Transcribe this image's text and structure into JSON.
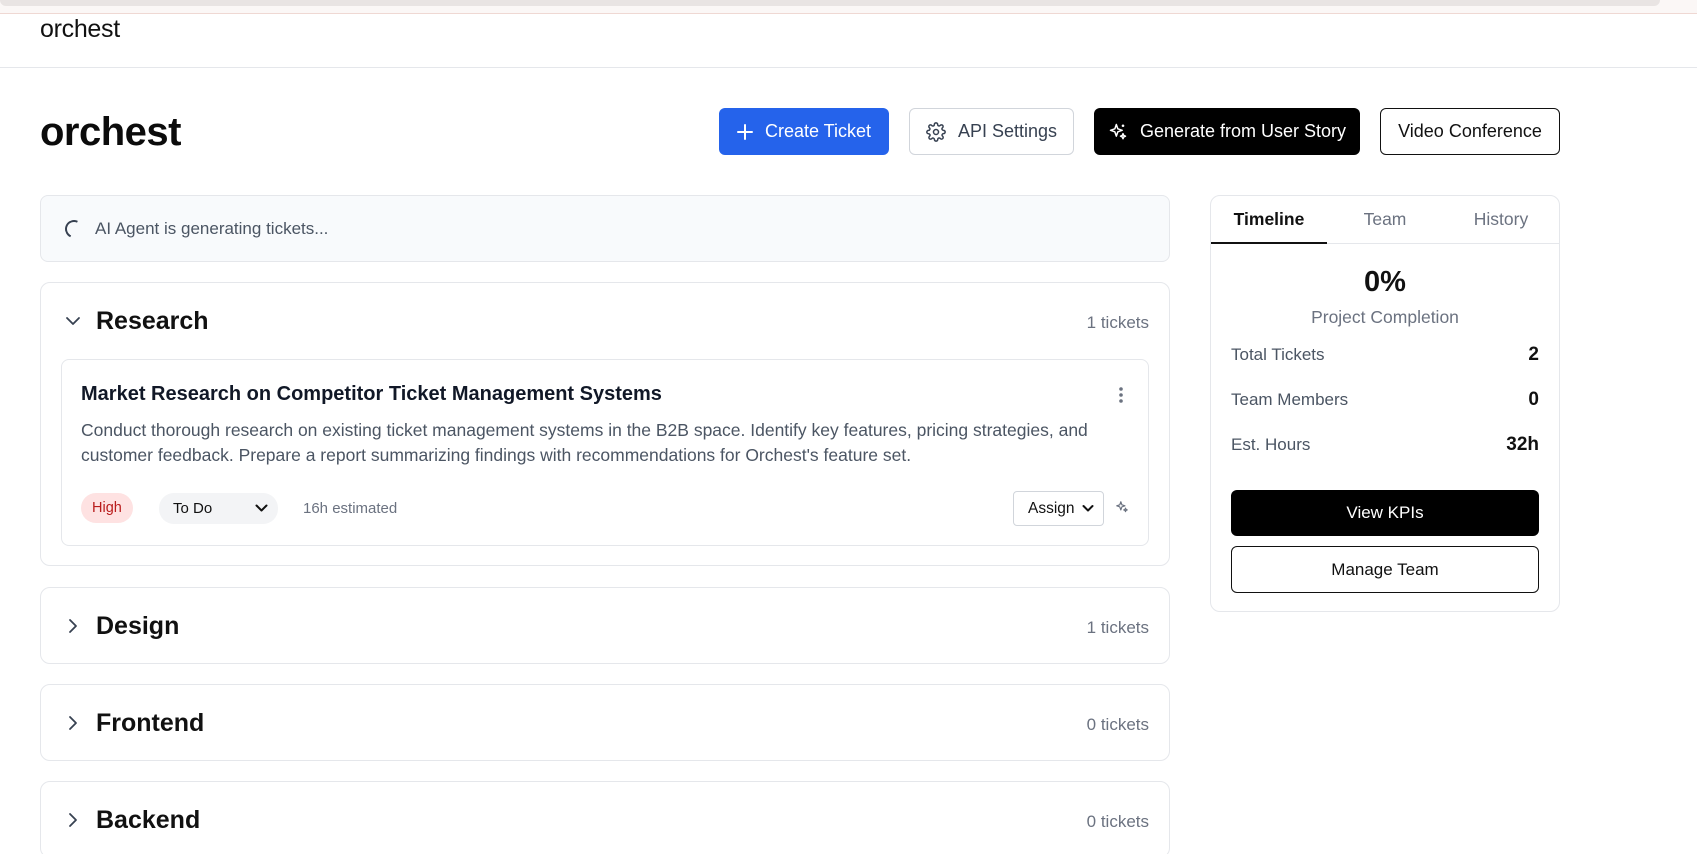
{
  "app": {
    "brand": "orchest"
  },
  "page": {
    "title": "orchest"
  },
  "toolbar": {
    "create_label": "Create Ticket",
    "api_label": "API Settings",
    "generate_label": "Generate from User Story",
    "video_label": "Video Conference"
  },
  "status": {
    "text": "AI Agent is generating tickets..."
  },
  "sections": [
    {
      "title": "Research",
      "count": "1 tickets",
      "expanded": true,
      "tickets": [
        {
          "title": "Market Research on Competitor Ticket Management Systems",
          "description": "Conduct thorough research on existing ticket management systems in the B2B space. Identify key features, pricing strategies, and customer feedback. Prepare a report summarizing findings with recommendations for Orchest's feature set.",
          "priority": "High",
          "status": "To Do",
          "estimate": "16h estimated",
          "assign": "Assign"
        }
      ]
    },
    {
      "title": "Design",
      "count": "1 tickets",
      "expanded": false
    },
    {
      "title": "Frontend",
      "count": "0 tickets",
      "expanded": false
    },
    {
      "title": "Backend",
      "count": "0 tickets",
      "expanded": false
    }
  ],
  "side_panel": {
    "tabs": [
      "Timeline",
      "Team",
      "History"
    ],
    "active_tab": "Timeline",
    "completion_value": "0%",
    "completion_label": "Project Completion",
    "stats": [
      {
        "label": "Total Tickets",
        "value": "2"
      },
      {
        "label": "Team Members",
        "value": "0"
      },
      {
        "label": "Est. Hours",
        "value": "32h"
      }
    ],
    "kpi_label": "View KPIs",
    "manage_label": "Manage Team"
  },
  "colors": {
    "primary": "#2563eb",
    "dark": "#000000",
    "priority_high_bg": "#fee2e2",
    "priority_high_text": "#b91c1c"
  },
  "icons": [
    "plus-icon",
    "gear-icon",
    "sparkles-icon",
    "spinner-icon",
    "chevron-down-icon",
    "chevron-right-icon",
    "more-vertical-icon"
  ]
}
